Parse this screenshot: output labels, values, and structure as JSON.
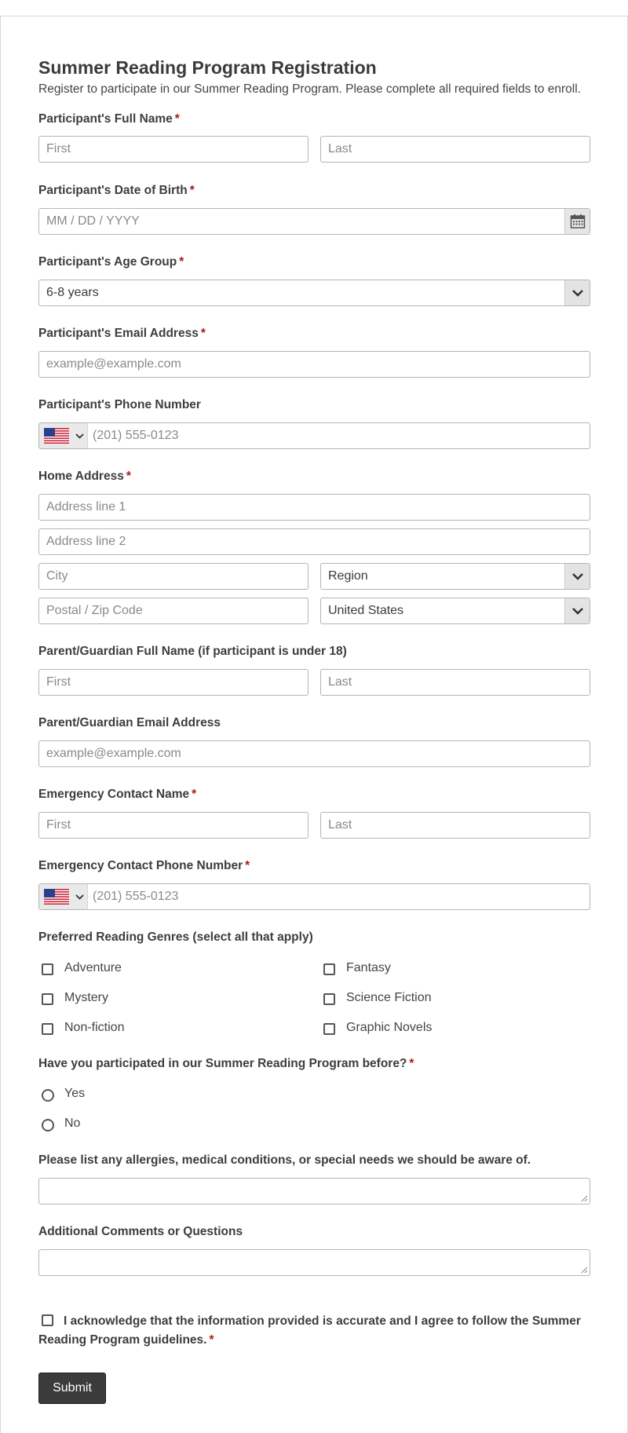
{
  "form": {
    "title": "Summer Reading Program Registration",
    "description": "Register to participate in our Summer Reading Program. Please complete all required fields to enroll.",
    "required_mark": "*",
    "participant_name": {
      "label": "Participant's Full Name",
      "first_placeholder": "First",
      "last_placeholder": "Last"
    },
    "dob": {
      "label": "Participant's Date of Birth",
      "placeholder": "MM / DD / YYYY"
    },
    "age_group": {
      "label": "Participant's Age Group",
      "selected": "6-8 years"
    },
    "email": {
      "label": "Participant's Email Address",
      "placeholder": "example@example.com"
    },
    "phone": {
      "label": "Participant's Phone Number",
      "placeholder": "(201) 555-0123",
      "country_flag": "us-flag-icon"
    },
    "address": {
      "label": "Home Address",
      "line1_placeholder": "Address line 1",
      "line2_placeholder": "Address line 2",
      "city_placeholder": "City",
      "region_selected": "Region",
      "postal_placeholder": "Postal / Zip Code",
      "country_selected": "United States"
    },
    "guardian_name": {
      "label": "Parent/Guardian Full Name (if participant is under 18)",
      "first_placeholder": "First",
      "last_placeholder": "Last"
    },
    "guardian_email": {
      "label": "Parent/Guardian Email Address",
      "placeholder": "example@example.com"
    },
    "emergency_name": {
      "label": "Emergency Contact Name",
      "first_placeholder": "First",
      "last_placeholder": "Last"
    },
    "emergency_phone": {
      "label": "Emergency Contact Phone Number",
      "placeholder": "(201) 555-0123"
    },
    "genres": {
      "label": "Preferred Reading Genres (select all that apply)",
      "options": [
        "Adventure",
        "Fantasy",
        "Mystery",
        "Science Fiction",
        "Non-fiction",
        "Graphic Novels"
      ]
    },
    "participated": {
      "label": "Have you participated in our Summer Reading Program before?",
      "options": [
        "Yes",
        "No"
      ]
    },
    "allergies": {
      "label": "Please list any allergies, medical conditions, or special needs we should be aware of."
    },
    "comments": {
      "label": "Additional Comments or Questions"
    },
    "acknowledge": {
      "text": "I acknowledge that the information provided is accurate and I agree to follow the Summer Reading Program guidelines."
    },
    "submit_label": "Submit"
  },
  "colors": {
    "required": "#b01717",
    "button_bg": "#3b3b3b",
    "border": "#b5b5b5"
  }
}
